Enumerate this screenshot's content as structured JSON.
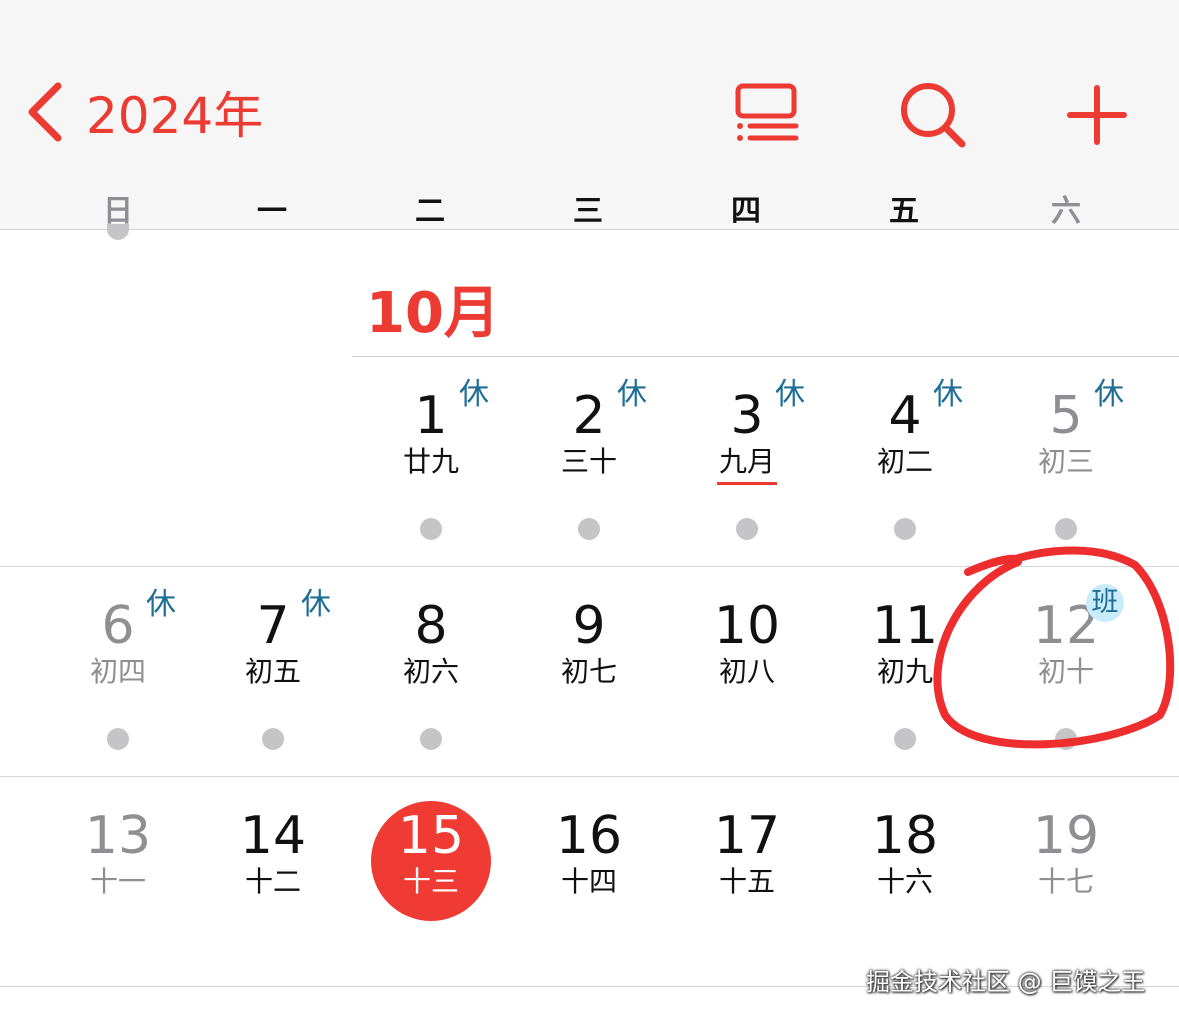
{
  "header": {
    "back_label": "2024年",
    "icons": [
      "calendar-list-icon",
      "search-icon",
      "plus-icon"
    ]
  },
  "weekdays": [
    "日",
    "一",
    "二",
    "三",
    "四",
    "五",
    "六"
  ],
  "month_label": "10月",
  "days": [
    {
      "num": "1",
      "lunar": "廿九",
      "badge": "休"
    },
    {
      "num": "2",
      "lunar": "三十",
      "badge": "休"
    },
    {
      "num": "3",
      "lunar": "九月",
      "badge": "休"
    },
    {
      "num": "4",
      "lunar": "初二",
      "badge": "休"
    },
    {
      "num": "5",
      "lunar": "初三",
      "badge": "休"
    },
    {
      "num": "6",
      "lunar": "初四",
      "badge": "休"
    },
    {
      "num": "7",
      "lunar": "初五",
      "badge": "休"
    },
    {
      "num": "8",
      "lunar": "初六"
    },
    {
      "num": "9",
      "lunar": "初七"
    },
    {
      "num": "10",
      "lunar": "初八"
    },
    {
      "num": "11",
      "lunar": "初九"
    },
    {
      "num": "12",
      "lunar": "初十",
      "badge": "班"
    },
    {
      "num": "13",
      "lunar": "十一"
    },
    {
      "num": "14",
      "lunar": "十二"
    },
    {
      "num": "15",
      "lunar": "十三"
    },
    {
      "num": "16",
      "lunar": "十四"
    },
    {
      "num": "17",
      "lunar": "十五"
    },
    {
      "num": "18",
      "lunar": "十六"
    },
    {
      "num": "19",
      "lunar": "十七"
    }
  ],
  "today": "15",
  "watermark": "掘金技术社区 @ 巨馍之王",
  "colors": {
    "accent": "#ec3b33",
    "holiday_badge": "#1f6e96",
    "workday_badge_bg": "#c9ecfa",
    "dot": "#c5c5c7",
    "weekend_text": "#8e8e93"
  }
}
